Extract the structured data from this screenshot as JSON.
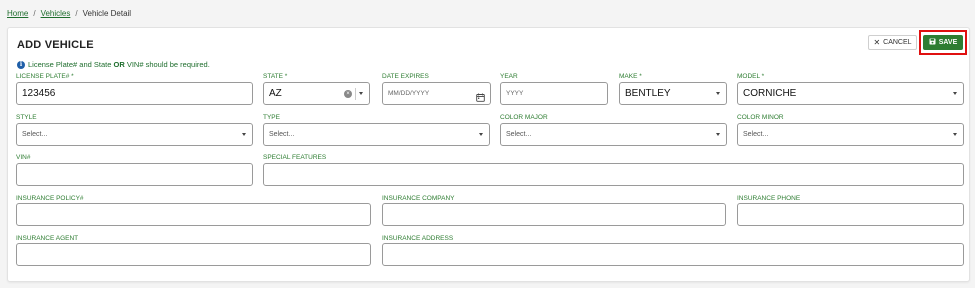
{
  "breadcrumb": {
    "home": "Home",
    "vehicles": "Vehicles",
    "current": "Vehicle Detail",
    "sep": "/"
  },
  "header": {
    "title": "ADD VEHICLE",
    "cancel_label": "CANCEL",
    "save_label": "SAVE"
  },
  "notice": {
    "pre": "License Plate# and State ",
    "bold": "OR",
    "post": " VIN# should be required."
  },
  "fields": {
    "license_plate": {
      "label": "LICENSE PLATE# *",
      "value": "123456"
    },
    "state": {
      "label": "STATE *",
      "value": "AZ"
    },
    "date_expires": {
      "label": "DATE EXPIRES",
      "placeholder": "MM/DD/YYYY"
    },
    "year": {
      "label": "YEAR",
      "placeholder": "YYYY"
    },
    "make": {
      "label": "MAKE *",
      "value": "BENTLEY"
    },
    "model": {
      "label": "MODEL *",
      "value": "CORNICHE"
    },
    "style": {
      "label": "STYLE",
      "placeholder": "Select..."
    },
    "type": {
      "label": "TYPE",
      "placeholder": "Select..."
    },
    "color_major": {
      "label": "COLOR MAJOR",
      "placeholder": "Select..."
    },
    "color_minor": {
      "label": "COLOR MINOR",
      "placeholder": "Select..."
    },
    "vin": {
      "label": "VIN#"
    },
    "special_features": {
      "label": "SPECIAL FEATURES"
    },
    "insurance_policy": {
      "label": "INSURANCE POLICY#"
    },
    "insurance_company": {
      "label": "INSURANCE COMPANY"
    },
    "insurance_phone": {
      "label": "INSURANCE PHONE"
    },
    "insurance_agent": {
      "label": "INSURANCE AGENT"
    },
    "insurance_address": {
      "label": "INSURANCE ADDRESS"
    }
  },
  "colors": {
    "accent": "#2e7d32",
    "highlight": "#e01010",
    "info": "#1f5fa8"
  }
}
